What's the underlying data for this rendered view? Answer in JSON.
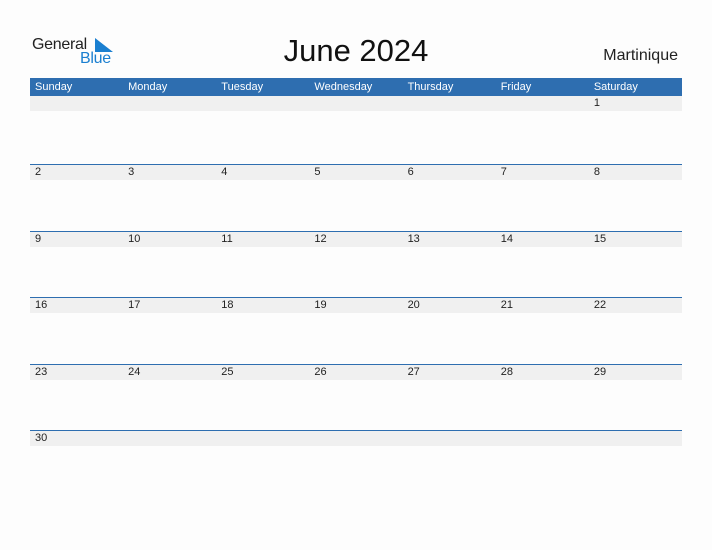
{
  "logo": {
    "line1": "General",
    "line2": "Blue"
  },
  "title": "June 2024",
  "region": "Martinique",
  "colors": {
    "accent": "#2e6eb0",
    "logo_blue": "#1a7fd0",
    "date_row_bg": "#f0f0f0"
  },
  "weekdays": [
    "Sunday",
    "Monday",
    "Tuesday",
    "Wednesday",
    "Thursday",
    "Friday",
    "Saturday"
  ],
  "weeks": [
    [
      "",
      "",
      "",
      "",
      "",
      "",
      "1"
    ],
    [
      "2",
      "3",
      "4",
      "5",
      "6",
      "7",
      "8"
    ],
    [
      "9",
      "10",
      "11",
      "12",
      "13",
      "14",
      "15"
    ],
    [
      "16",
      "17",
      "18",
      "19",
      "20",
      "21",
      "22"
    ],
    [
      "23",
      "24",
      "25",
      "26",
      "27",
      "28",
      "29"
    ],
    [
      "30",
      "",
      "",
      "",
      "",
      "",
      ""
    ]
  ]
}
